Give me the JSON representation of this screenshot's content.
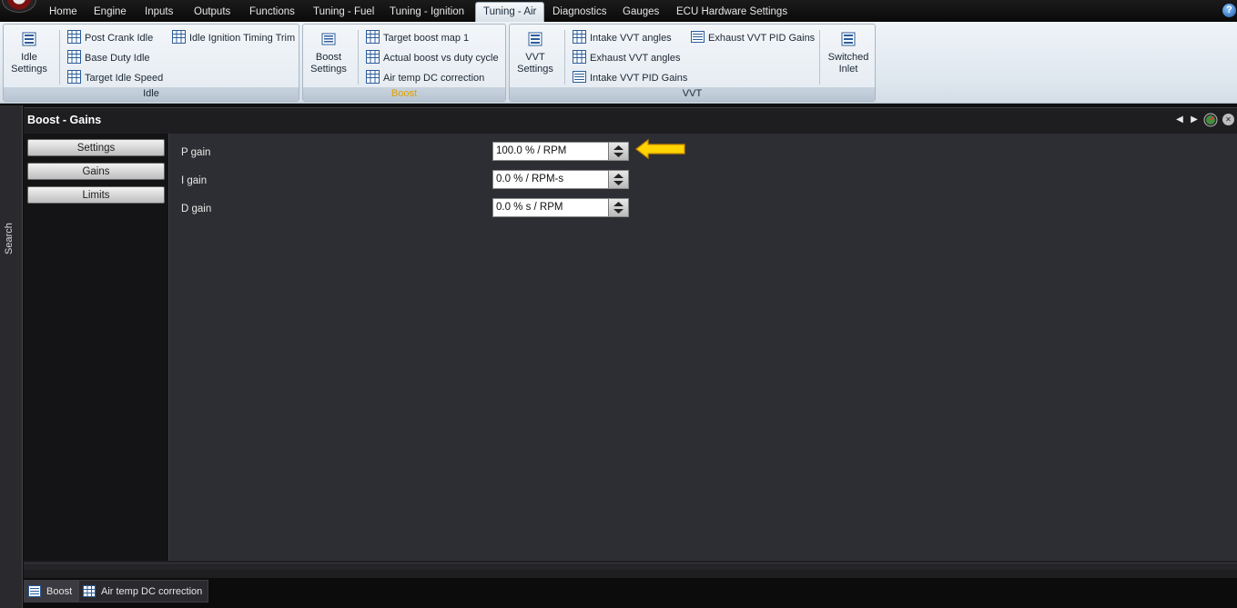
{
  "menu": {
    "tabs": [
      "Home",
      "Engine",
      "Inputs",
      "Outputs",
      "Functions",
      "Tuning - Fuel",
      "Tuning - Ignition",
      "Tuning - Air",
      "Diagnostics",
      "Gauges",
      "ECU Hardware Settings"
    ],
    "active": "Tuning - Air",
    "help_glyph": "?"
  },
  "ribbon": {
    "idle": {
      "label": "Idle",
      "big_button": {
        "line1": "Idle",
        "line2": "Settings"
      },
      "items": [
        "Post Crank Idle",
        "Base Duty Idle",
        "Target Idle Speed",
        "Idle Ignition Timing Trim"
      ]
    },
    "boost": {
      "label": "Boost",
      "big_button": {
        "line1": "Boost",
        "line2": "Settings"
      },
      "items": [
        "Target boost map 1",
        "Actual boost vs duty cycle",
        "Air temp DC correction"
      ]
    },
    "vvt": {
      "label": "VVT",
      "big_button": {
        "line1": "VVT",
        "line2": "Settings"
      },
      "items": [
        "Intake VVT angles",
        "Exhaust VVT angles",
        "Intake VVT PID Gains",
        "Exhaust VVT PID Gains"
      ],
      "switched_inlet": {
        "line1": "Switched",
        "line2": "Inlet"
      }
    }
  },
  "sidebar": {
    "search_label": "Search"
  },
  "panel": {
    "title": "Boost - Gains",
    "nav": [
      "Settings",
      "Gains",
      "Limits"
    ],
    "fields": [
      {
        "label": "P gain",
        "value": "100.0 % / RPM"
      },
      {
        "label": "I gain",
        "value": "0.0 % / RPM-s"
      },
      {
        "label": "D gain",
        "value": "0.0 % s / RPM"
      }
    ],
    "controls": {
      "prev": "◀",
      "next": "▶",
      "close": "✕"
    }
  },
  "bottom_tabs": [
    "Boost",
    "Air temp DC correction"
  ],
  "colors": {
    "accent_arrow": "#ffd400",
    "ribbon_bg": "#e3eaf1",
    "content_bg": "#2d2e33"
  }
}
